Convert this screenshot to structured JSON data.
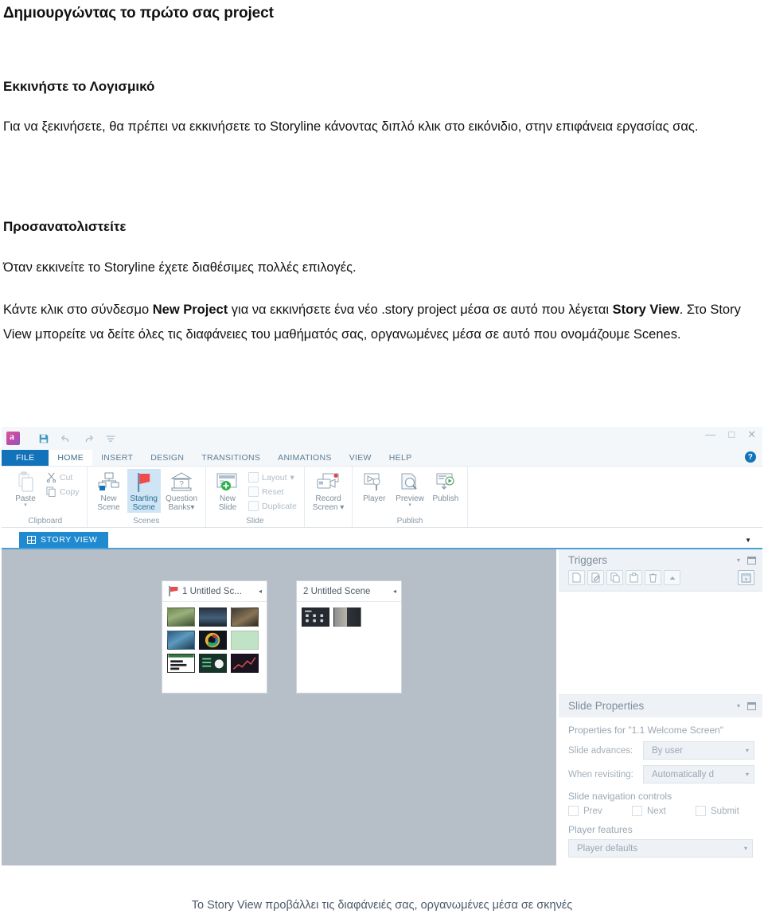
{
  "document": {
    "title": "Δημιουργώντας το πρώτο σας project",
    "section1": {
      "heading": "Εκκινήστε το Λογισμικό",
      "paragraph": "Για να ξεκινήσετε, θα πρέπει να εκκινήσετε το Storyline κάνοντας διπλό κλικ στο εικόνιδιο, στην επιφάνεια εργασίας σας."
    },
    "section2": {
      "heading": "Προσανατολιστείτε",
      "paragraph_a": "Όταν εκκινείτε το Storyline έχετε διαθέσιμες πολλές επιλογές.",
      "paragraph_b_1": "Κάντε κλικ στο σύνδεσμο ",
      "paragraph_b_bold1": "New Project",
      "paragraph_b_2": " για να εκκινήσετε ένα νέο .story project μέσα σε αυτό που λέγεται ",
      "paragraph_b_bold2": "Story View",
      "paragraph_b_3": ". Στο Story View μπορείτε να δείτε όλες τις διαφάνειες του μαθήματός σας, οργανωμένες μέσα σε αυτό που ονομάζουμε Scenes."
    },
    "caption": "Το Story View προβάλλει τις διαφάνειές σας, οργανωμένες μέσα σε σκηνές"
  },
  "app": {
    "logo": "articulate-storyline-logo",
    "quick_access": [
      {
        "name": "save-icon",
        "glyph": "💾"
      },
      {
        "name": "undo-icon",
        "glyph": "↶"
      },
      {
        "name": "redo-icon",
        "glyph": "↷"
      },
      {
        "name": "customize-qat-icon",
        "glyph": "≡"
      }
    ],
    "window_controls": {
      "minimize": "—",
      "maximize": "□",
      "close": "✕"
    },
    "help_label": "?",
    "tabs": [
      {
        "label": "FILE",
        "state": "file"
      },
      {
        "label": "HOME",
        "state": "active"
      },
      {
        "label": "INSERT",
        "state": "normal"
      },
      {
        "label": "DESIGN",
        "state": "normal"
      },
      {
        "label": "TRANSITIONS",
        "state": "normal"
      },
      {
        "label": "ANIMATIONS",
        "state": "normal"
      },
      {
        "label": "VIEW",
        "state": "normal"
      },
      {
        "label": "HELP",
        "state": "normal"
      }
    ],
    "ribbon": {
      "groups": [
        {
          "label": "Clipboard",
          "buttons": [
            {
              "name": "paste-button",
              "caption": "Paste",
              "caret": "▾"
            },
            {
              "name": "cut-button",
              "caption": "Cut"
            },
            {
              "name": "copy-button",
              "caption": "Copy"
            }
          ]
        },
        {
          "label": "Scenes",
          "buttons": [
            {
              "name": "new-scene-button",
              "caption_line1": "New",
              "caption_line2": "Scene"
            },
            {
              "name": "starting-scene-button",
              "caption_line1": "Starting",
              "caption_line2": "Scene",
              "selected": true
            },
            {
              "name": "question-banks-button",
              "caption_line1": "Question",
              "caption_line2": "Banks▾"
            }
          ]
        },
        {
          "label": "Slide",
          "buttons": [
            {
              "name": "new-slide-button",
              "caption_line1": "New",
              "caption_line2": "Slide"
            },
            {
              "name": "layout-button",
              "caption": "Layout",
              "caret": "▾"
            },
            {
              "name": "reset-button",
              "caption": "Reset"
            },
            {
              "name": "duplicate-button",
              "caption": "Duplicate"
            }
          ]
        },
        {
          "label": "",
          "buttons": [
            {
              "name": "record-screen-button",
              "caption_line1": "Record",
              "caption_line2": "Screen ▾"
            }
          ]
        },
        {
          "label": "Publish",
          "buttons": [
            {
              "name": "player-button",
              "caption": "Player"
            },
            {
              "name": "preview-button",
              "caption": "Preview",
              "caret": "▾"
            },
            {
              "name": "publish-button",
              "caption": "Publish"
            }
          ]
        }
      ]
    },
    "view_tab": {
      "label": "STORY VIEW",
      "caret": "▼"
    },
    "canvas": {
      "scenes": [
        {
          "name": "scene-1",
          "title": "1 Untitled Sc...",
          "has_flag": true,
          "collapse_caret": "◂",
          "slide_count": 9
        },
        {
          "name": "scene-2",
          "title": "2 Untitled Scene",
          "has_flag": false,
          "collapse_caret": "◂",
          "slide_count": 2
        }
      ]
    },
    "triggers_panel": {
      "title": "Triggers",
      "collapse_caret": "▾",
      "dock_icon": "dock-icon",
      "buttons": [
        {
          "name": "new-trigger-button",
          "glyph": "☐"
        },
        {
          "name": "edit-trigger-button",
          "glyph": "✎"
        },
        {
          "name": "copy-trigger-button",
          "glyph": "❐"
        },
        {
          "name": "paste-trigger-button",
          "glyph": "⎘"
        },
        {
          "name": "delete-trigger-button",
          "glyph": "🗑"
        },
        {
          "name": "move-up-trigger-button",
          "glyph": "▴"
        },
        {
          "name": "trigger-wizard-button",
          "glyph": "⌧"
        }
      ]
    },
    "slide_properties_panel": {
      "title": "Slide Properties",
      "collapse_caret": "▾",
      "properties_for": "Properties for \"1.1 Welcome Screen\"",
      "rows": [
        {
          "label": "Slide advances:",
          "value": "By user",
          "caret": "▾"
        },
        {
          "label": "When revisiting:",
          "value": "Automatically d",
          "caret": "▾"
        }
      ],
      "nav_controls_label": "Slide navigation controls",
      "nav_controls": [
        {
          "label": "Prev",
          "checked": false
        },
        {
          "label": "Next",
          "checked": false
        },
        {
          "label": "Submit",
          "checked": false
        }
      ],
      "player_features_label": "Player features",
      "player_features_value": "Player defaults",
      "player_features_caret": "▾"
    }
  },
  "colors": {
    "accent_blue": "#1273ba",
    "tab_blue": "#1f8ad0",
    "canvas_gray": "#b6bfc8",
    "panel_gray": "#eef2f6",
    "selected_ribbon": "#cfe5f5",
    "flag_red": "#ea4b4b"
  }
}
